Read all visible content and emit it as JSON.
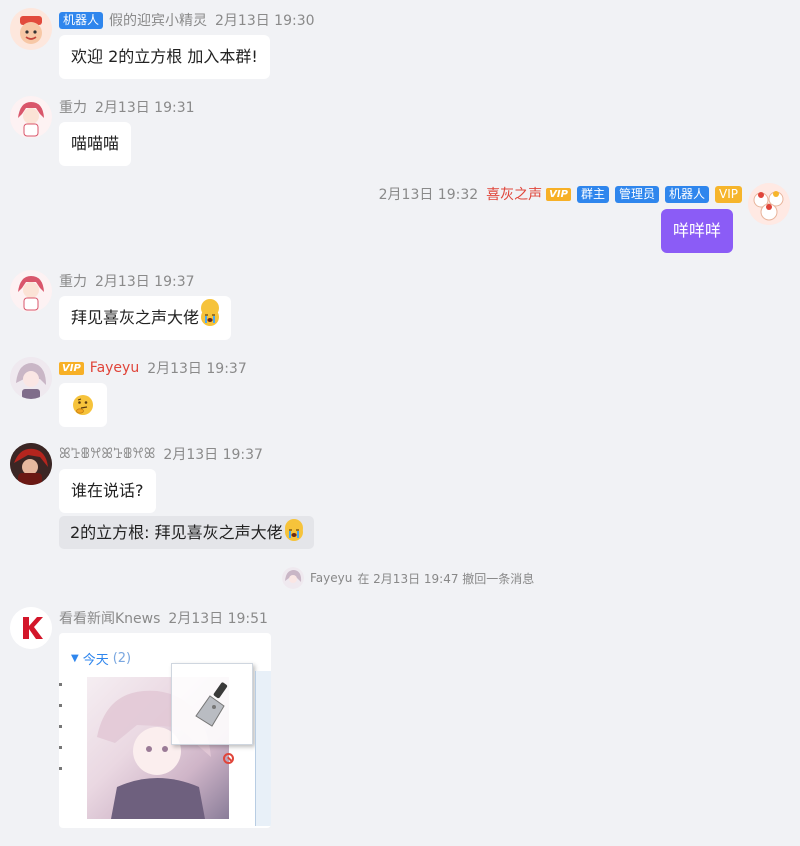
{
  "messages": [
    {
      "sender": "假的迎宾小精灵",
      "badge": "机器人",
      "time": "2月13日 19:30",
      "text": "欢迎 2的立方根 加入本群!"
    },
    {
      "sender": "重力",
      "time": "2月13日 19:31",
      "text": "喵喵喵"
    },
    {
      "sender": "喜灰之声",
      "time": "2月13日 19:32",
      "vip": "VIP",
      "tags": [
        "群主",
        "管理员",
        "机器人",
        "VIP"
      ],
      "text": "咩咩咩"
    },
    {
      "sender": "重力",
      "time": "2月13日 19:37",
      "text": "拜见喜灰之声大佬"
    },
    {
      "sender": "Fayeyu",
      "vip": "VIP",
      "time": "2月13日 19:37",
      "text": "thinking-face-emoji"
    },
    {
      "sender": "ꕤꕱꕬꕮꕤꕱꕬꕮꕤ",
      "time": "2月13日 19:37",
      "text": "谁在说话?",
      "reply": "2的立方根: 拜见喜灰之声大佬"
    },
    {
      "sender": "看看新闻Knews",
      "time": "2月13日 19:51",
      "image_tab": "今天",
      "image_count": "(2)"
    }
  ],
  "recall_notice": {
    "user": "Fayeyu",
    "text": "在 2月13日 19:47 撤回一条消息"
  },
  "colors": {
    "self_bubble": "#8b5cf6",
    "badge_blue": "#2f86ed",
    "badge_yellow": "#f6b52b",
    "name_red": "#e0453a"
  }
}
